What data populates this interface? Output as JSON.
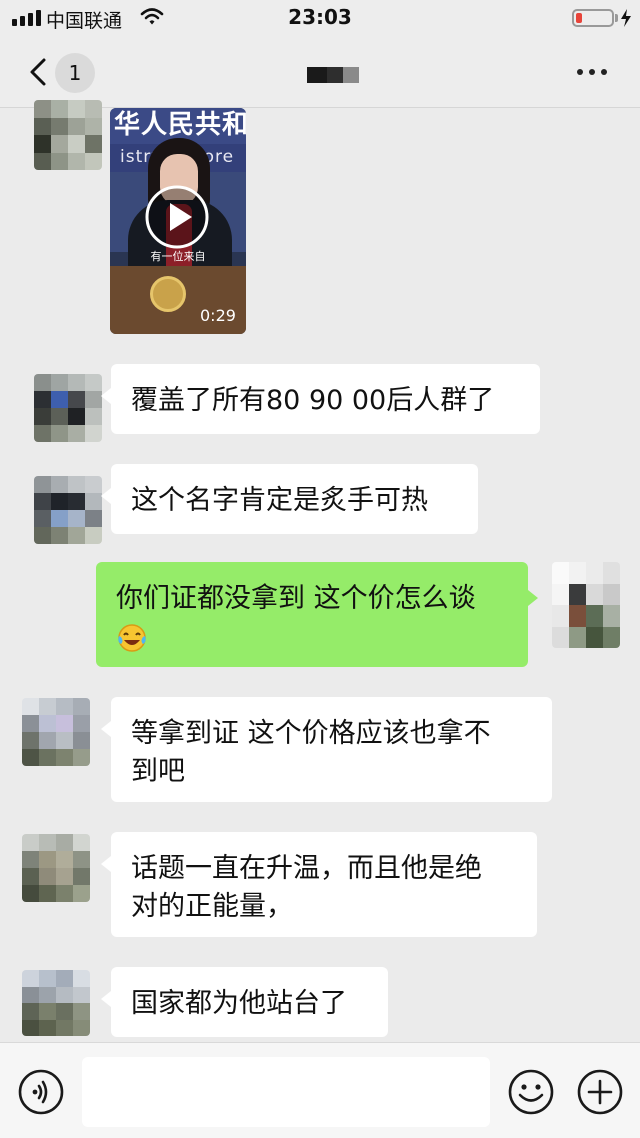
{
  "status_bar": {
    "carrier": "中国联通",
    "time": "23:03",
    "battery_level": 0.18,
    "icons": [
      "signal-icon",
      "wifi-icon",
      "battery-icon",
      "charging-icon"
    ]
  },
  "nav": {
    "back_icon": "chevron-left-icon",
    "unread_count": "1",
    "more_icon": "more-dots-icon"
  },
  "video": {
    "banner_text": "华人民共和",
    "banner_sub": "istry  of  Fore",
    "caption": "有一位来自",
    "duration": "0:29",
    "icon": "play-icon"
  },
  "messages": [
    {
      "side": "in",
      "lines": [
        "覆盖了所有80 90 00后人群了"
      ]
    },
    {
      "side": "in",
      "lines": [
        "这个名字肯定是炙手可热"
      ]
    },
    {
      "side": "out",
      "lines": [
        "你们证都没拿到 这个价怎么谈"
      ],
      "emoji": "laughing-tears-emoji"
    },
    {
      "side": "in",
      "lines": [
        "等拿到证  这个价格应该也拿不",
        "到吧"
      ]
    },
    {
      "side": "in",
      "lines": [
        "话题一直在升温，而且他是绝",
        "对的正能量，"
      ]
    },
    {
      "side": "in",
      "lines": [
        "国家都为他站台了"
      ]
    }
  ],
  "input_bar": {
    "voice_icon": "voice-icon",
    "emoji_icon": "smiley-icon",
    "plus_icon": "plus-icon",
    "input_value": ""
  },
  "colors": {
    "background": "#ebebeb",
    "bubble_in": "#ffffff",
    "bubble_out": "#95ec69",
    "battery_low": "#e8443a"
  }
}
